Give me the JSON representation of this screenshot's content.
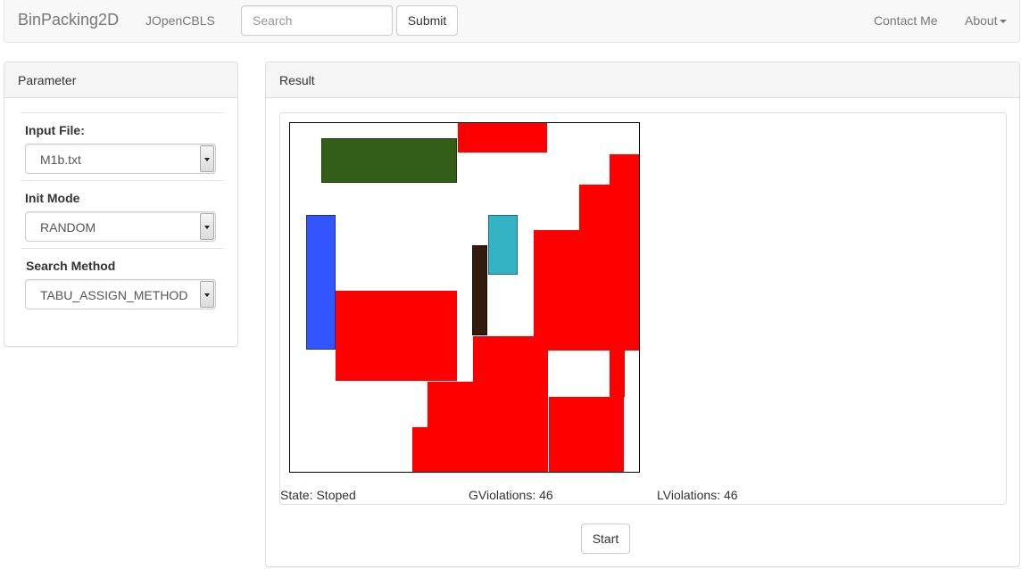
{
  "navbar": {
    "brand": "BinPacking2D",
    "link1": "JOpenCBLS",
    "search_placeholder": "Search",
    "submit_label": "Submit",
    "contact_label": "Contact Me",
    "about_label": "About"
  },
  "parameter": {
    "title": "Parameter",
    "input_file_label": "Input File:",
    "input_file_value": "M1b.txt",
    "init_mode_label": "Init Mode",
    "init_mode_value": "RANDOM",
    "search_method_label": "Search Method",
    "search_method_value": "TABU_ASSIGN_METHOD"
  },
  "result": {
    "title": "Result",
    "state_text": "State: Stoped",
    "gviolations_text": "GViolations: 46",
    "lviolations_text": "LViolations: 46",
    "start_label": "Start"
  },
  "colors": {
    "red": "#ff0000",
    "green": "#335e17",
    "blue": "#3355ff",
    "cyan": "#33b3c4",
    "brown": "#341b0d"
  }
}
